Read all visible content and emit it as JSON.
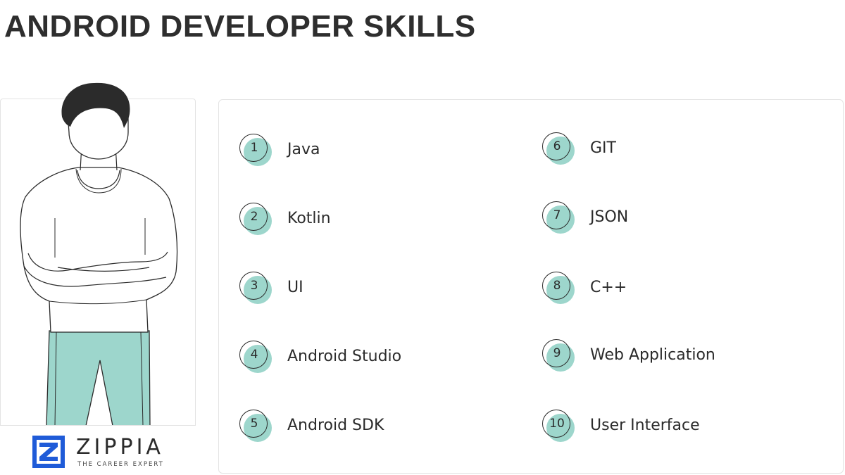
{
  "page": {
    "title": "ANDROID DEVELOPER SKILLS"
  },
  "brand": {
    "name": "ZIPPIA",
    "tagline": "THE CAREER EXPERT",
    "logo_color": "#1f5bd8",
    "accent_color": "#9dd6cc"
  },
  "illustration": {
    "icon": "person-arms-crossed-illustration"
  },
  "skills": {
    "left": [
      {
        "num": "1",
        "label": "Java"
      },
      {
        "num": "2",
        "label": "Kotlin"
      },
      {
        "num": "3",
        "label": "UI"
      },
      {
        "num": "4",
        "label": "Android Studio"
      },
      {
        "num": "5",
        "label": "Android SDK"
      }
    ],
    "right": [
      {
        "num": "6",
        "label": "GIT"
      },
      {
        "num": "7",
        "label": "JSON"
      },
      {
        "num": "8",
        "label": "C++"
      },
      {
        "num": "9",
        "label": "Web Application"
      },
      {
        "num": "10",
        "label": "User Interface"
      }
    ]
  }
}
